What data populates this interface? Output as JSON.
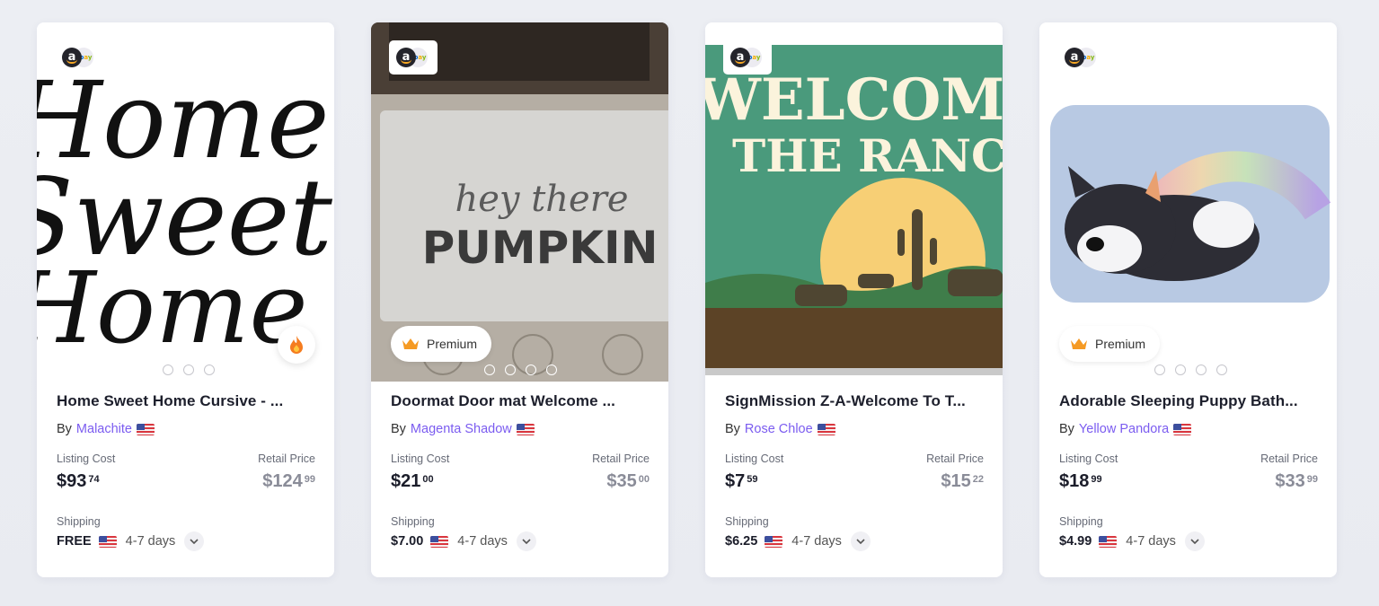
{
  "products": [
    {
      "title": "Home Sweet Home Cursive - ...",
      "by_prefix": "By",
      "seller": "Malachite",
      "listing_cost_label": "Listing Cost",
      "listing_cost_whole": "$93",
      "listing_cost_cents": "74",
      "retail_price_label": "Retail Price",
      "retail_price_whole": "$124",
      "retail_price_cents": "99",
      "shipping_label": "Shipping",
      "shipping_cost": "FREE",
      "shipping_days": "4-7 days",
      "badge": "fire",
      "image_text": [
        "Home",
        "Sweet",
        "Home"
      ]
    },
    {
      "title": "Doormat Door mat Welcome ...",
      "by_prefix": "By",
      "seller": "Magenta Shadow",
      "listing_cost_label": "Listing Cost",
      "listing_cost_whole": "$21",
      "listing_cost_cents": "00",
      "retail_price_label": "Retail Price",
      "retail_price_whole": "$35",
      "retail_price_cents": "00",
      "shipping_label": "Shipping",
      "shipping_cost": "$7.00",
      "shipping_days": "4-7 days",
      "badge": "Premium",
      "image_text": [
        "hey there",
        "PUMPKIN"
      ]
    },
    {
      "title": "SignMission Z-A-Welcome To T...",
      "by_prefix": "By",
      "seller": "Rose Chloe",
      "listing_cost_label": "Listing Cost",
      "listing_cost_whole": "$7",
      "listing_cost_cents": "59",
      "retail_price_label": "Retail Price",
      "retail_price_whole": "$15",
      "retail_price_cents": "22",
      "shipping_label": "Shipping",
      "shipping_cost": "$6.25",
      "shipping_days": "4-7 days",
      "badge": "none",
      "image_text": [
        "WELCOME",
        "THE RANC"
      ]
    },
    {
      "title": "Adorable Sleeping Puppy Bath...",
      "by_prefix": "By",
      "seller": "Yellow Pandora",
      "listing_cost_label": "Listing Cost",
      "listing_cost_whole": "$18",
      "listing_cost_cents": "99",
      "retail_price_label": "Retail Price",
      "retail_price_whole": "$33",
      "retail_price_cents": "99",
      "shipping_label": "Shipping",
      "shipping_cost": "$4.99",
      "shipping_days": "4-7 days",
      "badge": "Premium",
      "image_text": []
    }
  ],
  "icons": {
    "marketplace": "amazon-ebay-icon",
    "flag": "us-flag-icon",
    "expand": "chevron-down-icon",
    "hot": "fire-icon",
    "premium": "crown-icon"
  },
  "colors": {
    "seller_link": "#7b5cf0",
    "crown": "#f59a23",
    "fire": "#f57c1f"
  }
}
